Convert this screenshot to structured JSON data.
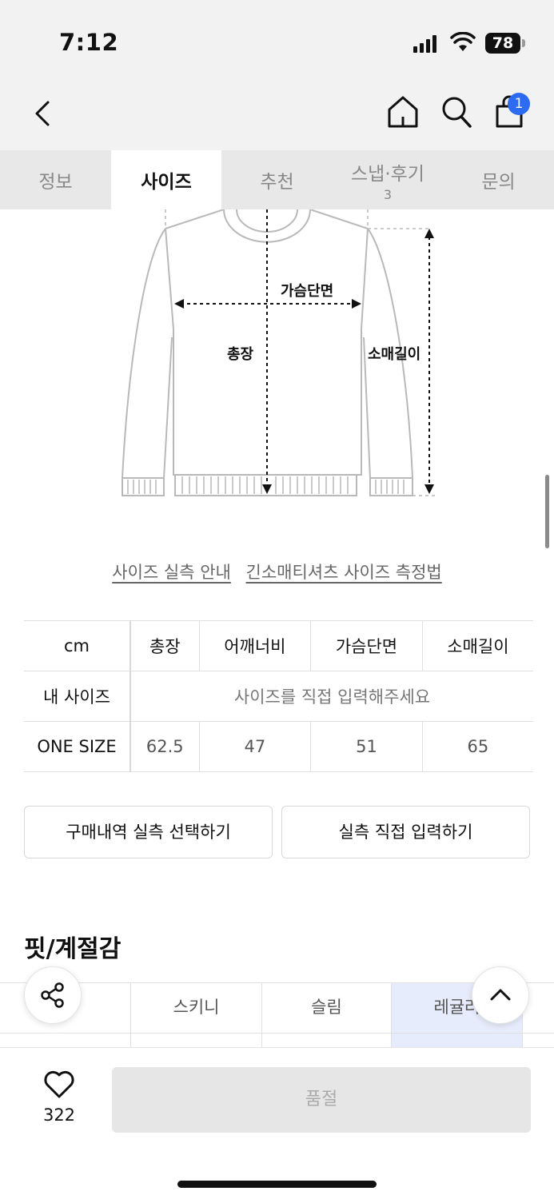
{
  "status": {
    "time": "7:12",
    "battery": "78"
  },
  "header": {
    "cart_count": "1"
  },
  "tabs": [
    {
      "label": "정보",
      "count": ""
    },
    {
      "label": "사이즈",
      "count": ""
    },
    {
      "label": "추천",
      "count": ""
    },
    {
      "label": "스냅·후기",
      "count": "3"
    },
    {
      "label": "문의",
      "count": ""
    }
  ],
  "diagram": {
    "chest_label": "가슴단면",
    "length_label": "총장",
    "sleeve_label": "소매길이"
  },
  "links": {
    "guide": "사이즈 실측 안내",
    "method": "긴소매티셔츠 사이즈 측정법"
  },
  "size_table": {
    "unit": "cm",
    "columns": [
      "총장",
      "어깨너비",
      "가슴단면",
      "소매길이"
    ],
    "my_size_label": "내 사이즈",
    "my_size_placeholder": "사이즈를 직접 입력해주세요",
    "rows": [
      {
        "name": "ONE SIZE",
        "values": [
          "62.5",
          "47",
          "51",
          "65"
        ]
      }
    ]
  },
  "buttons": {
    "purchase_history": "구매내역 실측 선택하기",
    "direct_input": "실측 직접 입력하기"
  },
  "fit": {
    "title": "핏/계절감",
    "options": [
      "스키니",
      "슬림",
      "레귤러"
    ],
    "selected": "레귤러"
  },
  "bottom": {
    "like_count": "322",
    "purchase_label": "품절"
  },
  "colors": {
    "accent": "#2c6bf2",
    "selected_bg": "#e6ecfb"
  }
}
